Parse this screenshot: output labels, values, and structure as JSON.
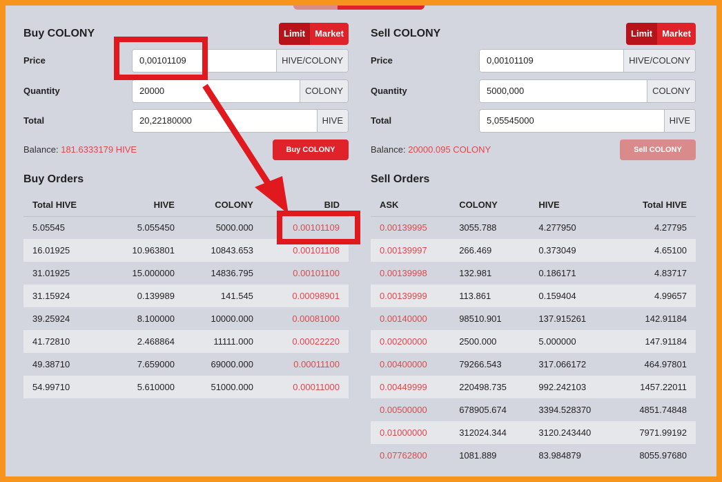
{
  "buy": {
    "title": "Buy COLONY",
    "mode": {
      "limit": "Limit",
      "market": "Market"
    },
    "price": {
      "label": "Price",
      "value": "0,00101109",
      "unit": "HIVE/COLONY"
    },
    "quantity": {
      "label": "Quantity",
      "value": "20000",
      "unit": "COLONY"
    },
    "total": {
      "label": "Total",
      "value": "20,22180000",
      "unit": "HIVE"
    },
    "balance": {
      "label": "Balance:",
      "value": "181.6333179 HIVE"
    },
    "submit": "Buy COLONY"
  },
  "sell": {
    "title": "Sell COLONY",
    "mode": {
      "limit": "Limit",
      "market": "Market"
    },
    "price": {
      "label": "Price",
      "value": "0,00101109",
      "unit": "HIVE/COLONY"
    },
    "quantity": {
      "label": "Quantity",
      "value": "5000,000",
      "unit": "COLONY"
    },
    "total": {
      "label": "Total",
      "value": "5,05545000",
      "unit": "HIVE"
    },
    "balance": {
      "label": "Balance:",
      "value": "20000.095 COLONY"
    },
    "submit": "Sell COLONY"
  },
  "buy_orders": {
    "title": "Buy Orders",
    "headers": [
      "Total HIVE",
      "HIVE",
      "COLONY",
      "BID"
    ],
    "rows": [
      [
        "5.05545",
        "5.055450",
        "5000.000",
        "0.00101109"
      ],
      [
        "16.01925",
        "10.963801",
        "10843.653",
        "0.00101108"
      ],
      [
        "31.01925",
        "15.000000",
        "14836.795",
        "0.00101100"
      ],
      [
        "31.15924",
        "0.139989",
        "141.545",
        "0.00098901"
      ],
      [
        "39.25924",
        "8.100000",
        "10000.000",
        "0.00081000"
      ],
      [
        "41.72810",
        "2.468864",
        "11111.000",
        "0.00022220"
      ],
      [
        "49.38710",
        "7.659000",
        "69000.000",
        "0.00011100"
      ],
      [
        "54.99710",
        "5.610000",
        "51000.000",
        "0.00011000"
      ]
    ]
  },
  "sell_orders": {
    "title": "Sell Orders",
    "headers": [
      "ASK",
      "COLONY",
      "HIVE",
      "Total HIVE"
    ],
    "rows": [
      [
        "0.00139995",
        "3055.788",
        "4.277950",
        "4.27795"
      ],
      [
        "0.00139997",
        "266.469",
        "0.373049",
        "4.65100"
      ],
      [
        "0.00139998",
        "132.981",
        "0.186171",
        "4.83717"
      ],
      [
        "0.00139999",
        "113.861",
        "0.159404",
        "4.99657"
      ],
      [
        "0.00140000",
        "98510.901",
        "137.915261",
        "142.91184"
      ],
      [
        "0.00200000",
        "2500.000",
        "5.000000",
        "147.91184"
      ],
      [
        "0.00400000",
        "79266.543",
        "317.066172",
        "464.97801"
      ],
      [
        "0.00449999",
        "220498.735",
        "992.242103",
        "1457.22011"
      ],
      [
        "0.00500000",
        "678905.674",
        "3394.528370",
        "4851.74848"
      ],
      [
        "0.01000000",
        "312024.344",
        "3120.243440",
        "7971.99192"
      ],
      [
        "0.07762800",
        "1081.889",
        "83.984879",
        "8055.97680"
      ]
    ]
  },
  "colors": {
    "accent": "#e0232a",
    "accent_dark": "#b8121a",
    "disabled": "#d98a8a",
    "price_red": "#e0474c",
    "annotation": "#e0191f",
    "border": "#f7941d",
    "background": "#d3d6de"
  }
}
